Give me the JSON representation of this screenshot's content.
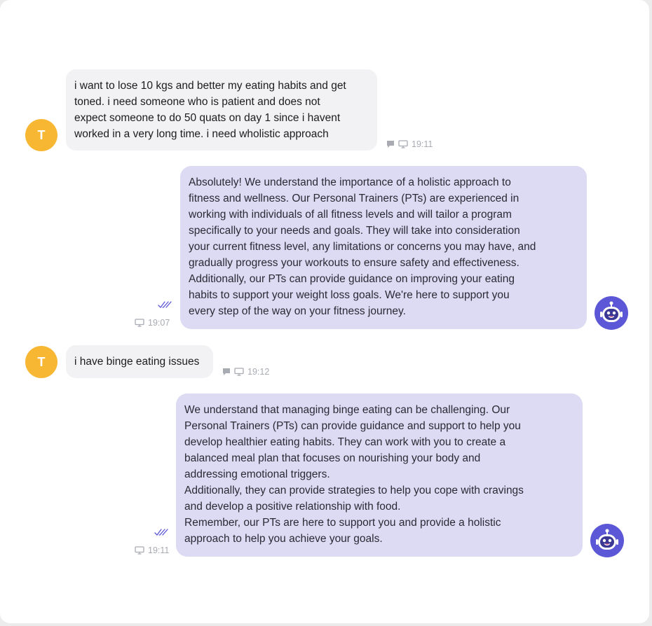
{
  "conversation": {
    "messages": [
      {
        "sender": "user",
        "avatar_letter": "T",
        "text": "i want to lose 10 kgs and better my eating habits and get\ntoned. i need someone who is patient and does not\nexpect someone to do 50 quats on day 1 since i havent\nworked in a very long time. i need wholistic approach",
        "time": "19:11"
      },
      {
        "sender": "bot",
        "text": "Absolutely! We understand the importance of a holistic approach to\nfitness and wellness. Our Personal Trainers (PTs) are experienced in\nworking with individuals of all fitness levels and will tailor a program\nspecifically to your needs and goals. They will take into consideration\nyour current fitness level, any limitations or concerns you may have, and\ngradually progress your workouts to ensure safety and effectiveness.\nAdditionally, our PTs can provide guidance on improving your eating\nhabits to support your weight loss goals. We're here to support you\nevery step of the way on your fitness journey.",
        "time": "19:07"
      },
      {
        "sender": "user",
        "avatar_letter": "T",
        "text": "i have binge eating issues",
        "time": "19:12"
      },
      {
        "sender": "bot",
        "text": "We understand that managing binge eating can be challenging. Our\nPersonal Trainers (PTs) can provide guidance and support to help you\ndevelop healthier eating habits. They can work with you to create a\nbalanced meal plan that focuses on nourishing your body and\naddressing emotional triggers.\nAdditionally, they can provide strategies to help you cope with cravings\nand develop a positive relationship with food.\nRemember, our PTs are here to support you and provide a holistic\napproach to help you achieve your goals.",
        "time": "19:11"
      }
    ]
  },
  "icons": {
    "chat": "chat-bubble-icon",
    "monitor": "monitor-icon",
    "read": "double-check-icon",
    "bot": "robot-icon"
  },
  "colors": {
    "user_avatar": "#f7b733",
    "bot_avatar": "#5b57d6",
    "user_bubble": "#f2f2f4",
    "bot_bubble": "#dcdbf3",
    "meta_text": "#a9abb3"
  }
}
